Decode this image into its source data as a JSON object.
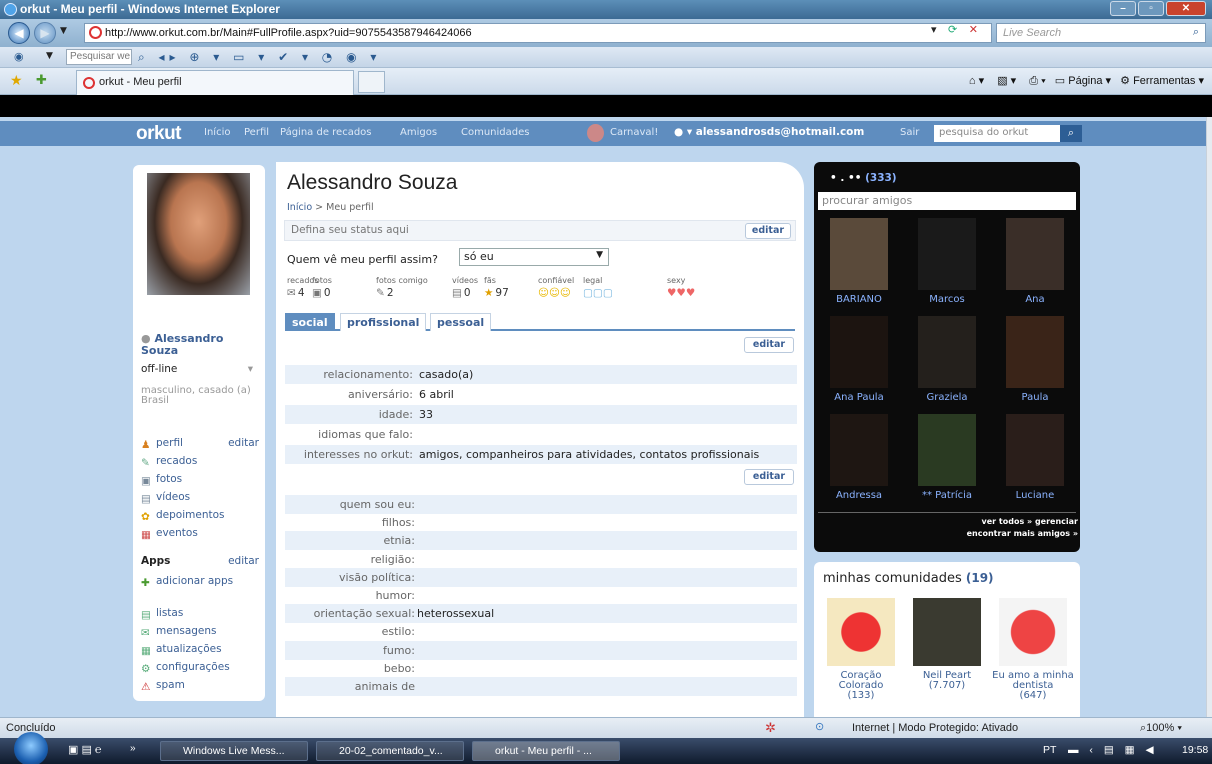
{
  "window": {
    "title": "orkut - Meu perfil - Windows Internet Explorer"
  },
  "browser": {
    "url": "http://www.orkut.com.br/Main#FullProfile.aspx?uid=9075543587946424066",
    "live_search": "Live Search",
    "toolbar_search": "Pesquisar we",
    "tab_title": "orkut - Meu perfil",
    "page_menu": "Página",
    "tools_menu": "Ferramentas"
  },
  "orkut_nav": {
    "logo": "orkut",
    "links": [
      "Início",
      "Perfil",
      "Página de recados",
      "Amigos",
      "Comunidades"
    ],
    "carnaval": "Carnaval!",
    "email": "alessandrosds@hotmail.com",
    "sair": "Sair",
    "search_placeholder": "pesquisa do orkut"
  },
  "sidebar": {
    "name": "Alessandro Souza",
    "status": "off-line",
    "info": "masculino, casado (a)",
    "country": "Brasil",
    "edit": "editar",
    "items": [
      {
        "label": "perfil",
        "icon": "user-icon"
      },
      {
        "label": "recados",
        "icon": "note-icon"
      },
      {
        "label": "fotos",
        "icon": "photo-icon"
      },
      {
        "label": "vídeos",
        "icon": "video-icon"
      },
      {
        "label": "depoimentos",
        "icon": "star-icon"
      },
      {
        "label": "eventos",
        "icon": "calendar-icon"
      }
    ],
    "apps_title": "Apps",
    "add_apps": "adicionar apps",
    "tools": [
      {
        "label": "listas",
        "icon": "list-icon"
      },
      {
        "label": "mensagens",
        "icon": "mail-icon"
      },
      {
        "label": "atualizações",
        "icon": "update-icon"
      },
      {
        "label": "configurações",
        "icon": "settings-icon"
      },
      {
        "label": "spam",
        "icon": "spam-icon"
      }
    ]
  },
  "profile": {
    "name": "Alessandro Souza",
    "breadcrumb_home": "Início",
    "breadcrumb_sep": ">",
    "breadcrumb_current": "Meu perfil",
    "status_placeholder": "Defina seu status aqui",
    "edit": "editar",
    "viewer_label": "Quem vê meu perfil assim?",
    "viewer_value": "só eu",
    "stats": [
      {
        "label": "recados",
        "value": "4"
      },
      {
        "label": "fotos",
        "value": "0"
      },
      {
        "label": "fotos comigo",
        "value": "2"
      },
      {
        "label": "vídeos",
        "value": "0"
      },
      {
        "label": "fãs",
        "value": "97"
      },
      {
        "label": "confiável",
        "value": ""
      },
      {
        "label": "legal",
        "value": ""
      },
      {
        "label": "sexy",
        "value": ""
      }
    ],
    "tabs": [
      "social",
      "profissional",
      "pessoal"
    ],
    "section1": [
      {
        "k": "relacionamento:",
        "v": "casado(a)"
      },
      {
        "k": "aniversário:",
        "v": "6 abril"
      },
      {
        "k": "idade:",
        "v": "33"
      },
      {
        "k": "idiomas que falo:",
        "v": ""
      },
      {
        "k": "interesses no orkut:",
        "v": "amigos, companheiros para atividades, contatos profissionais"
      }
    ],
    "section2": [
      {
        "k": "quem sou eu:",
        "v": ""
      },
      {
        "k": "filhos:",
        "v": ""
      },
      {
        "k": "etnia:",
        "v": ""
      },
      {
        "k": "religião:",
        "v": ""
      },
      {
        "k": "visão política:",
        "v": ""
      },
      {
        "k": "humor:",
        "v": ""
      },
      {
        "k": "orientação sexual:",
        "v": "heterossexual"
      },
      {
        "k": "estilo:",
        "v": ""
      },
      {
        "k": "fumo:",
        "v": ""
      },
      {
        "k": "bebo:",
        "v": ""
      },
      {
        "k": "animais de",
        "v": ""
      }
    ]
  },
  "friends": {
    "title": "•  .  ••",
    "count": "(333)",
    "search_placeholder": "procurar amigos",
    "list": [
      "BARIANO",
      "Marcos",
      "Ana",
      "Ana Paula",
      "Graziela",
      "Paula",
      "Andressa",
      "** Patrícia",
      "Luciane"
    ],
    "more1": "ver todos »   gerenciar",
    "more2": "encontrar mais amigos »"
  },
  "communities": {
    "title": "minhas comunidades",
    "count": "(19)",
    "list": [
      {
        "name": "Coração Colorado",
        "count": "(133)"
      },
      {
        "name": "Neil Peart",
        "count": "(7.707)"
      },
      {
        "name": "Eu amo a minha dentista",
        "count": "(647)"
      }
    ]
  },
  "statusbar": {
    "text": "Concluído",
    "zone": "Internet | Modo Protegido: Ativado",
    "zoom": "100%"
  },
  "taskbar": {
    "items": [
      "Windows Live Mess...",
      "20-02_comentado_v...",
      "orkut - Meu perfil - ..."
    ],
    "lang": "PT",
    "clock": "19:58"
  }
}
